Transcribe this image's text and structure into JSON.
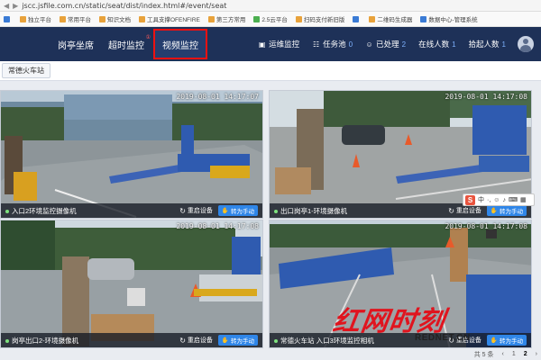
{
  "browser": {
    "url": "jscc.jsfile.com.cn/static/seat/dist/index.html#/event/seat",
    "bookmarks": [
      "",
      "独立平台",
      "常用平台",
      "知识文档",
      "工具支撑OFENFIRE",
      "第三方常用",
      "2.5云平台",
      "扫码支付新旧版",
      "",
      "二维码生成器",
      "数据中心-管理系统"
    ]
  },
  "header": {
    "tabs": [
      {
        "label": "岗亭坐席",
        "active": false
      },
      {
        "label": "超时监控",
        "active": false,
        "badge": "①"
      },
      {
        "label": "视频监控",
        "active": true
      }
    ],
    "right": [
      {
        "icon": "monitor-icon",
        "label": "运维监控",
        "num": ""
      },
      {
        "icon": "task-icon",
        "label": "任务池",
        "num": "0"
      },
      {
        "icon": "user-check-icon",
        "label": "已处理",
        "num": "2"
      },
      {
        "icon": "",
        "label": "在线人数",
        "num": "1"
      },
      {
        "icon": "",
        "label": "拾起人数",
        "num": "1"
      }
    ]
  },
  "station": {
    "selected": "常德火车站"
  },
  "cameras": [
    {
      "name": "入口2环境监控摄像机",
      "timestamp": "2019-08-01 14:17:07",
      "restart": "重启设备",
      "manual": "转为手动"
    },
    {
      "name": "出口岗亭1-环境摄像机",
      "timestamp": "2019-08-01 14:17:08",
      "restart": "重启设备",
      "manual": "转为手动"
    },
    {
      "name": "岗亭出口2-环境摄像机",
      "timestamp": "2019-08-01 14:17:08",
      "restart": "重启设备",
      "manual": "转为手动"
    },
    {
      "name": "常德火车站 入口3环境监控相机",
      "timestamp": "2019-08-01 14:17:08",
      "restart": "重启设备",
      "manual": "转为手动"
    }
  ],
  "pager": {
    "total": "共 5 条",
    "prev": "‹",
    "pages": [
      "1",
      "2"
    ],
    "current": "2",
    "next": "›"
  },
  "watermark": {
    "main": "红网时刻",
    "sub": "REDNET.CN"
  },
  "ime": {
    "logo": "S",
    "mode": "中"
  },
  "colors": {
    "header_bg": "#1e3158",
    "active_border": "#e11111",
    "accent_blue": "#2f86e8",
    "watermark_red": "#e0141e"
  }
}
